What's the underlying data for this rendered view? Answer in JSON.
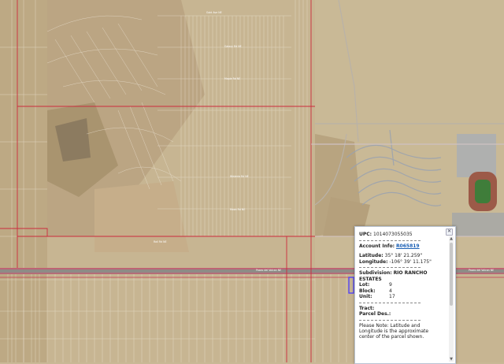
{
  "map": {
    "street_labels": [
      "Paseo del Volcan NE",
      "Paseo del Volcan NE",
      "Gold Ave NE",
      "Galaxy Rd NE",
      "Maple Rd NE",
      "Wisteria Rd NE",
      "Moon Rd NE",
      "Rail Rd NE"
    ]
  },
  "popup": {
    "upc_label": "UPC:",
    "upc_value": "1014073055035",
    "account_label": "Account Info:",
    "account_value": "R065819",
    "latitude_label": "Latitude:",
    "latitude_value": "35° 18' 21.259\"",
    "longitude_label": "Longitude:",
    "longitude_value": "-106° 39' 11.175\"",
    "subdivision_label": "Subdivision:",
    "subdivision_value": "RIO RANCHO",
    "subdivision_value_2": "ESTATES",
    "lot_label": "Lot:",
    "lot_value": "9",
    "block_label": "Block:",
    "block_value": "4",
    "unit_label": "Unit:",
    "unit_value": "17",
    "tract_label": "Tract:",
    "parcel_label": "Parcel Des.:",
    "note": "Please Note: Latitude and Longitude is the approximate center of the parcel shown.",
    "close_glyph": "✕",
    "scroll_up": "▲",
    "scroll_down": "▼"
  }
}
